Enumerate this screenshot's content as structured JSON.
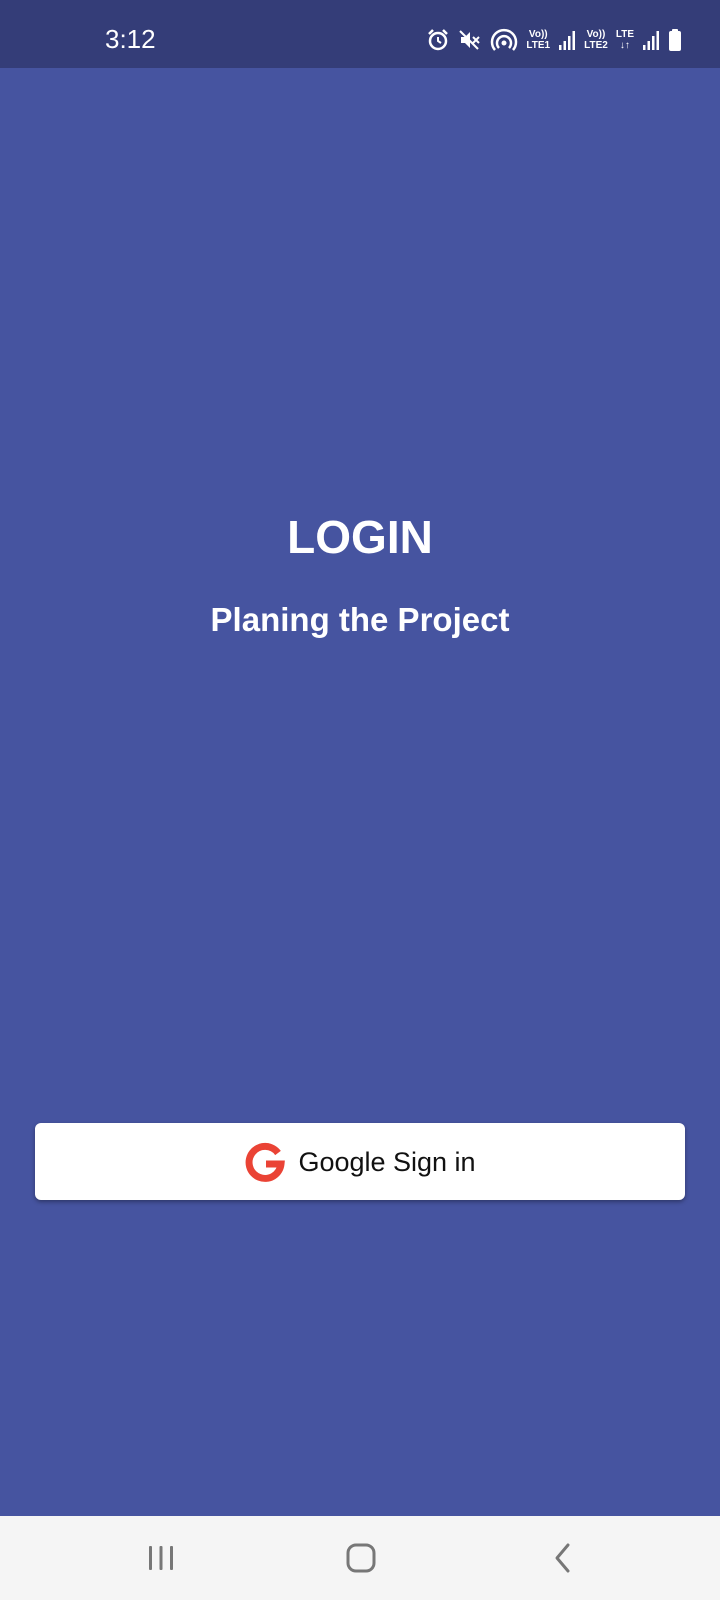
{
  "status_bar": {
    "time": "3:12",
    "icons": [
      "alarm-icon",
      "mute-icon",
      "hotspot-icon",
      "volte1-icon",
      "signal1-icon",
      "volte2-icon",
      "lte-data-icon",
      "signal2-icon",
      "battery-icon"
    ],
    "volte1": {
      "top": "Vo))",
      "bottom": "LTE1"
    },
    "volte2": {
      "top": "Vo))",
      "bottom": "LTE2"
    },
    "lte": {
      "top": "LTE",
      "bottom": "↓↑"
    }
  },
  "main": {
    "title": "LOGIN",
    "subtitle": "Planing the Project",
    "google_button": {
      "label": "Google Sign in",
      "icon": "google-g-icon"
    }
  },
  "colors": {
    "background": "#4654a0",
    "status_bar": "#343d78",
    "button": "#ffffff",
    "google_red": "#ea4335",
    "nav_bar": "#f5f5f5"
  },
  "nav_bar": {
    "buttons": [
      "recent-apps-icon",
      "home-icon",
      "back-icon"
    ]
  }
}
